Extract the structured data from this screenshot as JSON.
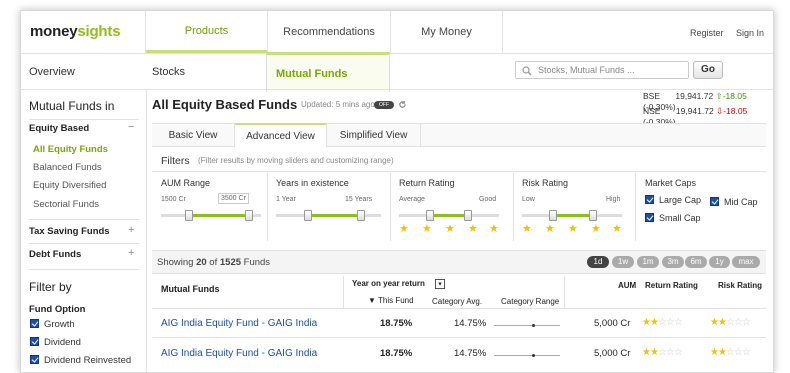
{
  "logo": {
    "part1": "money",
    "part2": "sights"
  },
  "topnav": {
    "tabs": [
      {
        "label": "Products"
      },
      {
        "label": "Recommendations"
      },
      {
        "label": "My Money"
      }
    ],
    "register": "Register",
    "signin": "Sign In"
  },
  "subnav": {
    "tabs": [
      {
        "label": "Overview"
      },
      {
        "label": "Stocks"
      },
      {
        "label": "Mutual Funds"
      }
    ],
    "search_placeholder": "Stocks, Mutual Funds ...",
    "go": "Go"
  },
  "sidebar": {
    "heading": "Mutual Funds in",
    "equity": {
      "label": "Equity Based",
      "toggle": "−",
      "items": [
        {
          "label": "All Equity Funds"
        },
        {
          "label": "Balanced Funds"
        },
        {
          "label": "Equity Diversified"
        },
        {
          "label": "Sectorial Funds"
        }
      ]
    },
    "tax": {
      "label": "Tax Saving Funds",
      "toggle": "+"
    },
    "debt": {
      "label": "Debt Funds",
      "toggle": "+"
    },
    "filter_by": "Filter by",
    "fund_option": "Fund Option",
    "options": [
      {
        "label": "Growth"
      },
      {
        "label": "Dividend"
      },
      {
        "label": "Dividend Reinvested"
      }
    ]
  },
  "main": {
    "title": "All Equity Based Funds",
    "updated": "Updated: 5 mins ago",
    "toggle": "OFF",
    "bse": {
      "name": "BSE",
      "value": "19,941.72",
      "arrow": "⇧",
      "change": "-18.05",
      "pct": "(-0.30%)"
    },
    "nse": {
      "name": "NSE",
      "value": "19,941.72",
      "arrow": "⇩",
      "change": "-18.05",
      "pct": "(-0.30%)"
    },
    "views": [
      {
        "label": "Basic View"
      },
      {
        "label": "Advanced View"
      },
      {
        "label": "Simplified View"
      }
    ],
    "filters_title": "Filters",
    "filters_sub": "(Filter results by moving sliders and customizing range)",
    "aum": {
      "label": "AUM Range",
      "min": "1500 Cr",
      "max": "3500 Cr"
    },
    "years": {
      "label": "Years in existence",
      "min": "1 Year",
      "max": "15 Years"
    },
    "return_rating": {
      "label": "Return Rating",
      "min": "Average",
      "max": "Good",
      "stars": 5
    },
    "risk_rating": {
      "label": "Risk Rating",
      "min": "Low",
      "max": "High",
      "stars": 5
    },
    "market_caps": {
      "label": "Market Caps",
      "large": "Large Cap",
      "mid": "Mid Cap",
      "small": "Small Cap"
    },
    "showing": {
      "prefix": "Showing ",
      "count": "20",
      "middle": " of ",
      "total": "1525",
      "suffix": " Funds"
    },
    "periods": [
      "1d",
      "1w",
      "1m",
      "3m",
      "6m",
      "1y",
      "max"
    ],
    "active_period": "1d",
    "table": {
      "col_fund": "Mutual Funds",
      "col_yoy": "Year on year return",
      "col_this": "▼ This Fund",
      "col_cat": "Category Avg.",
      "col_range": "Category Range",
      "col_aum": "AUM",
      "col_return": "Return Rating",
      "col_risk": "Risk Rating",
      "rows": [
        {
          "name": "AIG India Equity Fund - GAIG India",
          "this": "18.75%",
          "cat": "14.75%",
          "aum": "5,000 Cr",
          "return_stars": 2,
          "risk_stars": 2
        },
        {
          "name": "AIG India Equity Fund - GAIG India",
          "this": "18.75%",
          "cat": "14.75%",
          "aum": "5,000 Cr",
          "return_stars": 2,
          "risk_stars": 2
        }
      ]
    }
  }
}
